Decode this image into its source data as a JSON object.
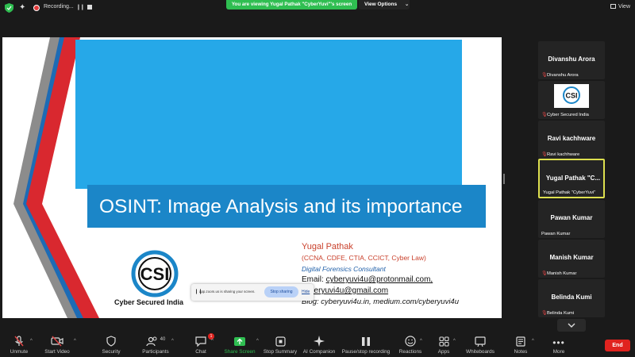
{
  "topbar": {
    "recording_label": "Recording...",
    "viewing_banner": "You are viewing Yugal Pathak \"CyberYuvi\"'s screen",
    "view_options": "View Options",
    "view_label": "View"
  },
  "slide": {
    "title": "OSINT: Image Analysis and its importance",
    "logo_name": "Cyber Secured India",
    "author": "Yugal Pathak",
    "credentials": "(CCNA, CDFE, CTIA, CCICT, Cyber Law)",
    "role": "Digital Forensics Consultant",
    "email_prefix": "Email: ",
    "email1": "cyberyuvi4u@protonmail.com,",
    "email2": "cyberyuvi4u@gmail.com",
    "blog": "Blog: cyberyuvi4u.in, medium.com/cyberyuvi4u"
  },
  "sharing_toast": {
    "message": "app.zoom.us is sharing your screen.",
    "stop_label": "Stop sharing",
    "hide_label": "Hide"
  },
  "participants": [
    {
      "name": "Divanshu Arora",
      "label": "Divanshu Arora"
    },
    {
      "name": "",
      "label": "Cyber Secured India",
      "logo": "CSI"
    },
    {
      "name": "Ravi kachhware",
      "label": "Ravi kachhware"
    },
    {
      "name": "Yugal  Pathak  \"C...",
      "label": "Yugal Pathak \"CyberYuvi\"",
      "active": true
    },
    {
      "name": "Pawan Kumar",
      "label": "Pawan Kumar"
    },
    {
      "name": "Manish Kumar",
      "label": "Manish Kumar"
    },
    {
      "name": "Belinda Kumi",
      "label": "Belinda Kumi"
    }
  ],
  "toolbar": {
    "unmute": "Unmute",
    "start_video": "Start Video",
    "security": "Security",
    "participants": "Participants",
    "participants_count": "40",
    "chat": "Chat",
    "chat_badge": "1",
    "share_screen": "Share Screen",
    "stop_summary": "Stop Summary",
    "ai_companion": "AI Companion",
    "pause_recording": "Pause/stop recording",
    "reactions": "Reactions",
    "apps": "Apps",
    "whiteboards": "Whiteboards",
    "notes": "Notes",
    "more": "More",
    "end": "End"
  },
  "colors": {
    "share_green": "#2fbe51",
    "end_red": "#e0231f",
    "slide_blue": "#26a8e8",
    "title_band": "#1b86c8",
    "active_border": "#dde04f"
  }
}
